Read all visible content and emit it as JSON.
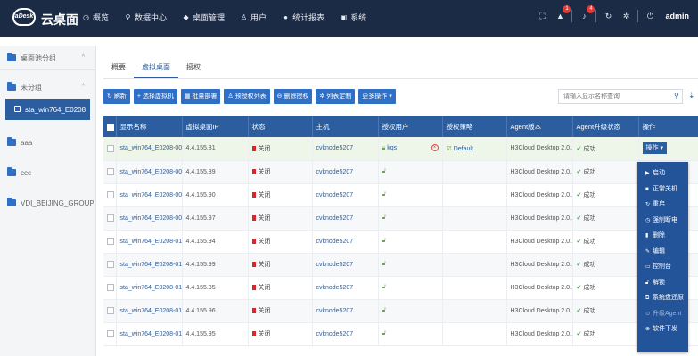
{
  "app": {
    "logo_text": "aDesk",
    "brand": "云桌面"
  },
  "nav": [
    {
      "icon": "clock-icon",
      "label": "概览"
    },
    {
      "icon": "pin-icon",
      "label": "数据中心"
    },
    {
      "icon": "desktop-icon",
      "label": "桌面管理"
    },
    {
      "icon": "users-icon",
      "label": "用户"
    },
    {
      "icon": "report-icon",
      "label": "统计报表"
    },
    {
      "icon": "system-icon",
      "label": "系统"
    }
  ],
  "topbar": {
    "badge_alerts": "1",
    "badge_notices": "4",
    "user": "admin"
  },
  "sidebar": {
    "root_group": "桌面池分组",
    "ungrouped": "未分组",
    "selected_pool": "sta_win764_E0208",
    "groups": [
      "aaa",
      "ccc",
      "VDI_BEIJING_GROUP"
    ]
  },
  "tabs": [
    "概要",
    "虚拟桌面",
    "授权"
  ],
  "toolbar": {
    "buttons": [
      "刷新",
      "选择虚拟机",
      "批量部署",
      "预授权列表",
      "删除授权",
      "列表定制",
      "更多操作"
    ],
    "search_placeholder": "请输入显示名称查询"
  },
  "table": {
    "headers": [
      "显示名称",
      "虚拟桌面IP",
      "状态",
      "主机",
      "授权用户",
      "授权策略",
      "Agent版本",
      "Agent升级状态",
      "操作"
    ],
    "rows": [
      {
        "name": "sta_win764_E0208-006",
        "ip": "4.4.155.81",
        "status": "关闭",
        "host": "cvknode5207",
        "user": "kqs",
        "policy": "Default",
        "agent": "H3Cloud Desktop 2.0...",
        "upgrade": "成功",
        "op": "操作"
      },
      {
        "name": "sta_win764_E0208-007",
        "ip": "4.4.155.89",
        "status": "关闭",
        "host": "cvknode5207",
        "user": "",
        "policy": "",
        "agent": "H3Cloud Desktop 2.0...",
        "upgrade": "成功",
        "op": ""
      },
      {
        "name": "sta_win764_E0208-008",
        "ip": "4.4.155.90",
        "status": "关闭",
        "host": "cvknode5207",
        "user": "",
        "policy": "",
        "agent": "H3Cloud Desktop 2.0...",
        "upgrade": "成功",
        "op": ""
      },
      {
        "name": "sta_win764_E0208-009",
        "ip": "4.4.155.97",
        "status": "关闭",
        "host": "cvknode5207",
        "user": "",
        "policy": "",
        "agent": "H3Cloud Desktop 2.0...",
        "upgrade": "成功",
        "op": ""
      },
      {
        "name": "sta_win764_E0208-010",
        "ip": "4.4.155.94",
        "status": "关闭",
        "host": "cvknode5207",
        "user": "",
        "policy": "",
        "agent": "H3Cloud Desktop 2.0...",
        "upgrade": "成功",
        "op": ""
      },
      {
        "name": "sta_win764_E0208-011",
        "ip": "4.4.155.99",
        "status": "关闭",
        "host": "cvknode5207",
        "user": "",
        "policy": "",
        "agent": "H3Cloud Desktop 2.0...",
        "upgrade": "成功",
        "op": ""
      },
      {
        "name": "sta_win764_E0208-012",
        "ip": "4.4.155.85",
        "status": "关闭",
        "host": "cvknode5207",
        "user": "",
        "policy": "",
        "agent": "H3Cloud Desktop 2.0...",
        "upgrade": "成功",
        "op": ""
      },
      {
        "name": "sta_win764_E0208-013",
        "ip": "4.4.155.96",
        "status": "关闭",
        "host": "cvknode5207",
        "user": "",
        "policy": "",
        "agent": "H3Cloud Desktop 2.0...",
        "upgrade": "成功",
        "op": ""
      },
      {
        "name": "sta_win764_E0208-014",
        "ip": "4.4.155.95",
        "status": "关闭",
        "host": "cvknode5207",
        "user": "",
        "policy": "",
        "agent": "H3Cloud Desktop 2.0...",
        "upgrade": "成功",
        "op": ""
      }
    ]
  },
  "menu": {
    "items": [
      {
        "icon": "play-icon",
        "label": "启动",
        "disabled": false
      },
      {
        "icon": "stop-icon",
        "label": "正常关机",
        "disabled": false
      },
      {
        "icon": "restart-icon",
        "label": "重启",
        "disabled": false
      },
      {
        "icon": "refresh-icon",
        "label": "强制断电",
        "disabled": false
      },
      {
        "icon": "trash-icon",
        "label": "删除",
        "disabled": false
      },
      {
        "icon": "edit-icon",
        "label": "编辑",
        "disabled": false
      },
      {
        "icon": "console-icon",
        "label": "控制台",
        "disabled": false
      },
      {
        "icon": "unlock-icon",
        "label": "解锁",
        "disabled": false
      },
      {
        "icon": "restore-icon",
        "label": "系统盘还原",
        "disabled": false
      },
      {
        "icon": "upgrade-icon",
        "label": "升级Agent",
        "disabled": true
      },
      {
        "icon": "software-icon",
        "label": "软件下发",
        "disabled": false
      }
    ]
  }
}
